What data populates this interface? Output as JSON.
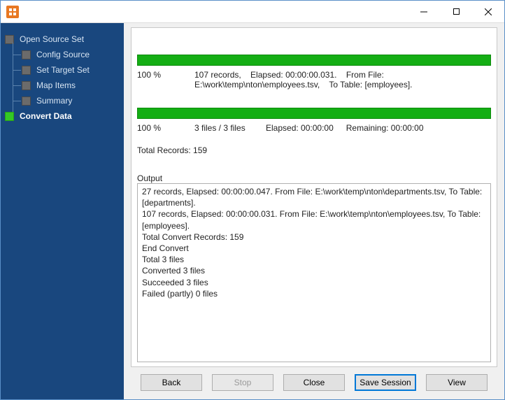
{
  "sidebar": {
    "root_label": "Open Source Set",
    "children": [
      {
        "label": "Config Source"
      },
      {
        "label": "Set Target Set"
      },
      {
        "label": "Map Items"
      },
      {
        "label": "Summary"
      }
    ],
    "active_label": "Convert Data"
  },
  "progress": {
    "file": {
      "percent": "100 %",
      "records": "107 records,",
      "path": "E:\\work\\temp\\nton\\employees.tsv,",
      "elapsed": "Elapsed: 00:00:00.031.",
      "from": "From File:",
      "to": "To Table: [employees]."
    },
    "total": {
      "percent": "100 %",
      "files": "3 files / 3 files",
      "elapsed": "Elapsed: 00:00:00",
      "remaining": "Remaining: 00:00:00",
      "total_records": "Total Records: 159"
    }
  },
  "output": {
    "label": "Output",
    "lines": [
      "27 records,    Elapsed: 00:00:00.047.    From File: E:\\work\\temp\\nton\\departments.tsv,    To Table: [departments].",
      "107 records,    Elapsed: 00:00:00.031.    From File: E:\\work\\temp\\nton\\employees.tsv,    To Table: [employees].",
      "Total Convert Records: 159",
      "End Convert",
      "Total 3 files",
      "Converted 3 files",
      "Succeeded 3 files",
      "Failed (partly) 0 files"
    ]
  },
  "buttons": {
    "back": "Back",
    "stop": "Stop",
    "close": "Close",
    "save_session": "Save Session",
    "view": "View"
  }
}
